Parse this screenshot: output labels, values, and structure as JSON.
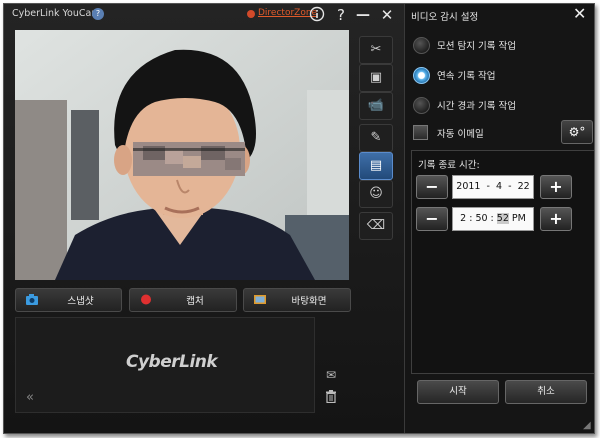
{
  "app": {
    "title": "CyberLink YouCam",
    "help_badge": "?",
    "director_zone": "DirectorZone",
    "titlebar_icons": [
      "info-icon",
      "help-icon",
      "minimize-icon",
      "close-icon"
    ]
  },
  "tools": [
    "tools-icon",
    "frame-icon",
    "surveillance-camera-icon",
    "pencil-icon",
    "monitor-settings-icon",
    "add-user-icon",
    "eraser-icon"
  ],
  "actions": {
    "snapshot": "스냅샷",
    "capture": "캡처",
    "desktop": "바탕화면"
  },
  "library": {
    "logo": "CyberLink",
    "collapse": "«"
  },
  "panel": {
    "title": "비디오 감시 설정",
    "options": [
      {
        "label": "모션 탐지 기록 작업",
        "selected": false
      },
      {
        "label": "연속 기록 작업",
        "selected": true
      },
      {
        "label": "시간 경과 기록 작업",
        "selected": false
      }
    ],
    "auto_email": "자동 이메일",
    "end_time_title": "기록 종료 시간:",
    "date": {
      "year": "2011",
      "sep1": "-",
      "month": "4",
      "sep2": "-",
      "day": "22"
    },
    "time": {
      "hour": "2",
      "minute": "50",
      "second": "52",
      "ampm": "PM"
    },
    "start": "시작",
    "cancel": "취소"
  },
  "colors": {
    "accent_blue": "#3f6fa8",
    "director_zone": "#e05a2a",
    "radio_selected": "#5fb7ee"
  }
}
